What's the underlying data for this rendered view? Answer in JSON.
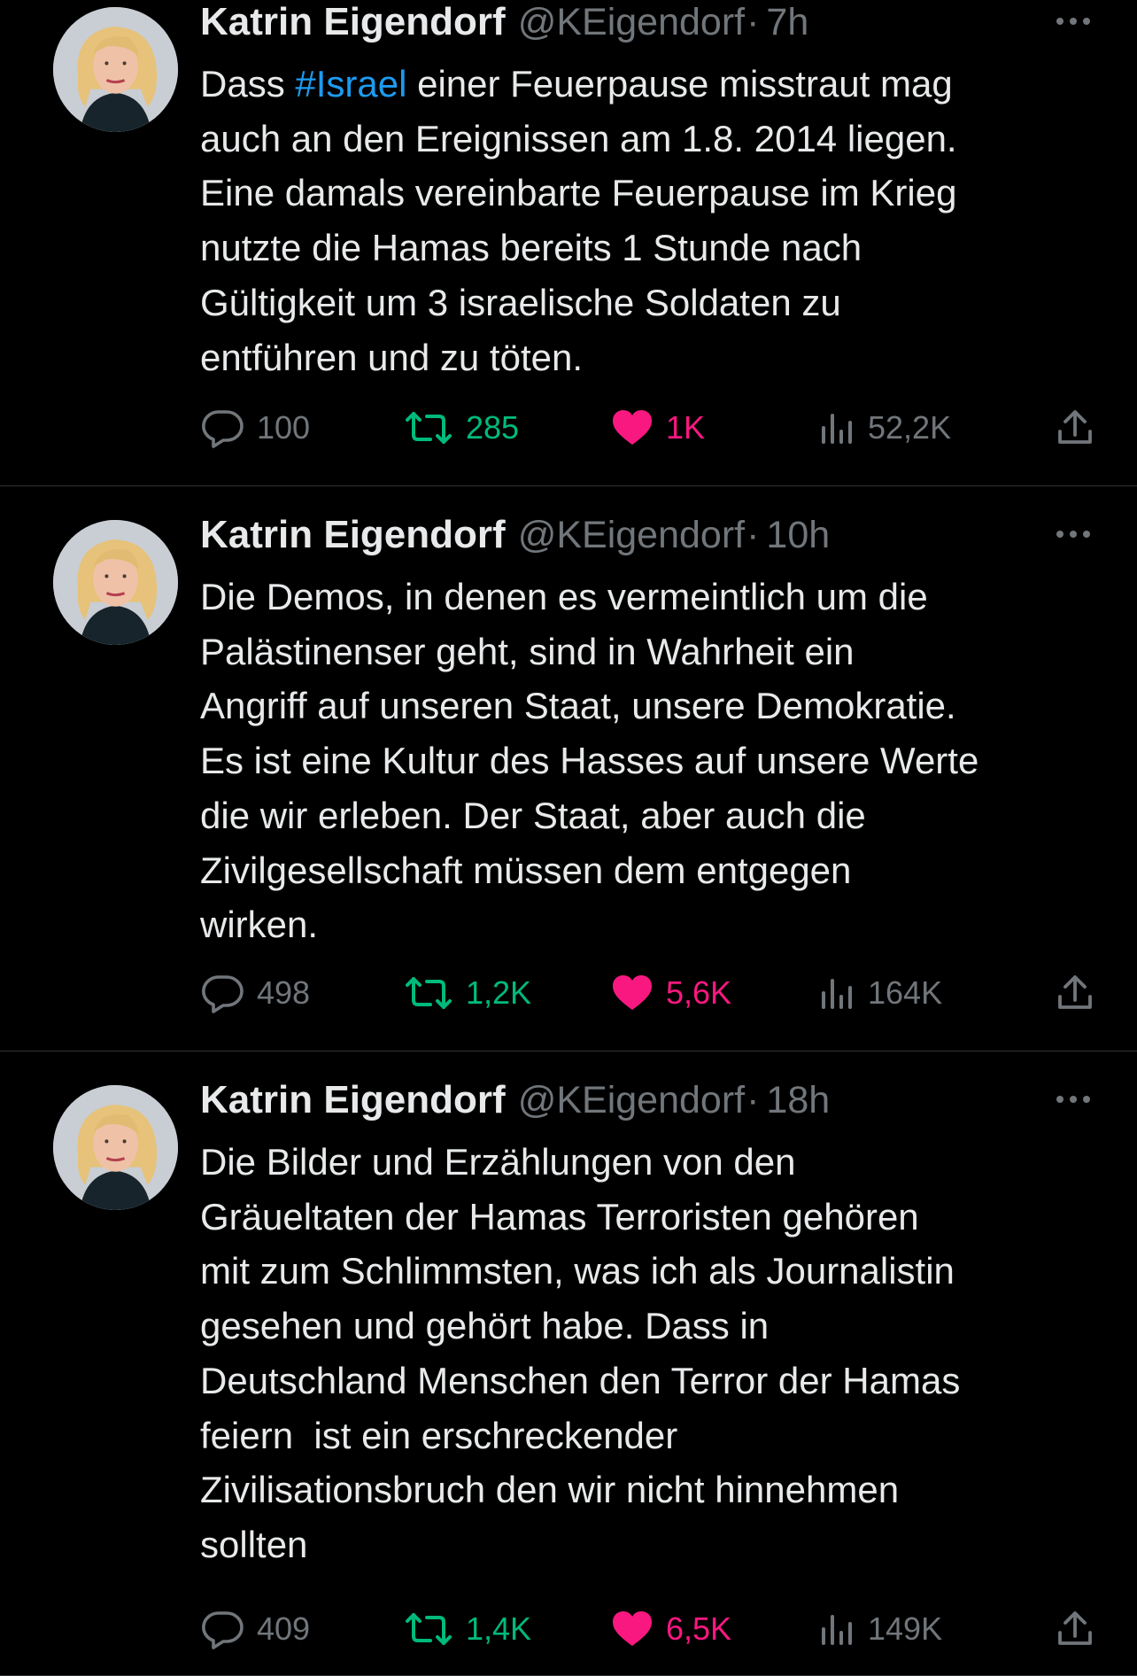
{
  "colors": {
    "background": "#000000",
    "text": "#e7e9ea",
    "muted": "#71767b",
    "link": "#1d9bf0",
    "retweet": "#00ba7c",
    "like": "#f91880",
    "divider": "#2f3336"
  },
  "tweets": [
    {
      "author": "Katrin Eigendorf",
      "handle": "@KEigendorf",
      "separator": "·",
      "time": "7h",
      "text_lines": [
        [
          "Dass ",
          "#Israel",
          " einer Feuerpause misstraut mag"
        ],
        "auch an den Ereignissen am 1.8. 2014 liegen.",
        "Eine damals vereinbarte Feuerpause im Krieg",
        "nutzte die Hamas bereits 1 Stunde nach",
        "Gültigkeit um 3 israelische Soldaten zu",
        "entführen und zu töten."
      ],
      "replies": "100",
      "retweets": "285",
      "likes": "1K",
      "views": "52,2K"
    },
    {
      "author": "Katrin Eigendorf",
      "handle": "@KEigendorf",
      "separator": "·",
      "time": "10h",
      "text_lines": [
        "Die Demos, in denen es vermeintlich um die",
        "Palästinenser geht, sind in Wahrheit ein",
        "Angriff auf unseren Staat, unsere Demokratie.",
        "Es ist eine Kultur des Hasses auf unsere Werte",
        "die wir erleben. Der Staat, aber auch die",
        "Zivilgesellschaft müssen dem entgegen",
        "wirken."
      ],
      "replies": "498",
      "retweets": "1,2K",
      "likes": "5,6K",
      "views": "164K"
    },
    {
      "author": "Katrin Eigendorf",
      "handle": "@KEigendorf",
      "separator": "·",
      "time": "18h",
      "text_lines": [
        "Die Bilder und Erzählungen von den",
        "Gräueltaten der Hamas Terroristen gehören",
        "mit zum Schlimmsten, was ich als Journalistin",
        "gesehen und gehört habe. Dass in",
        "Deutschland Menschen den Terror der Hamas",
        "feiern  ist ein erschreckender",
        "Zivilisationsbruch den wir nicht hinnehmen",
        "sollten"
      ],
      "replies": "409",
      "retweets": "1,4K",
      "likes": "6,5K",
      "views": "149K"
    }
  ]
}
